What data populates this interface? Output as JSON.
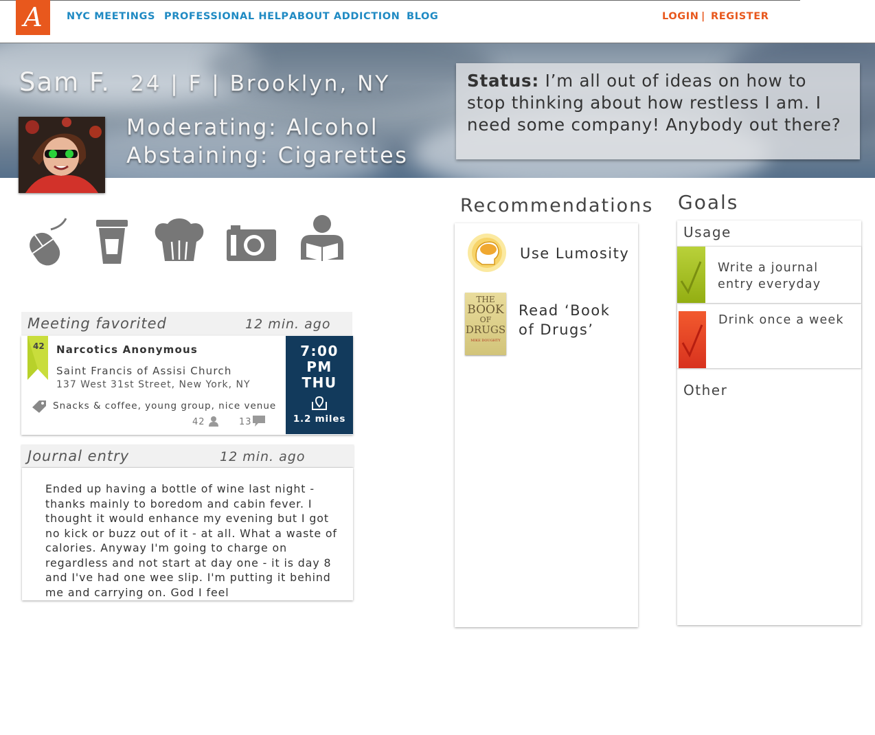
{
  "nav": {
    "logo": "A",
    "links": [
      "NYC MEETINGS",
      "PROFESSIONAL HELP",
      "ABOUT ADDICTION",
      "BLOG"
    ],
    "login": "LOGIN",
    "separator": "|",
    "register": "REGISTER"
  },
  "profile": {
    "name": "Sam F.",
    "meta": "24 | F | Brooklyn, NY",
    "moderating": "Moderating: Alcohol",
    "abstaining": "Abstaining: Cigarettes",
    "status_label": "Status:",
    "status_text": "I’m all out of ideas on how to stop thinking about how restless I am. I need some company! Anybody out there?"
  },
  "interest_icons": [
    "mouse-icon",
    "coffee-cup-icon",
    "chef-hat-icon",
    "camera-icon",
    "reading-person-icon"
  ],
  "meeting_card": {
    "header": "Meeting favorited",
    "time_ago": "12 min. ago",
    "badge_count": "42",
    "title": "Narcotics Anonymous",
    "venue": "Saint Francis of Assisi Church",
    "address": "137 West 31st Street, New York, NY",
    "tags": "Snacks & coffee, young group, nice venue",
    "attendees": "42",
    "comments": "13",
    "time": "7:00",
    "ampm": "PM",
    "day": "THU",
    "distance": "1.2 miles"
  },
  "journal_card": {
    "header": "Journal entry",
    "time_ago": "12 min. ago",
    "text": "Ended up having a bottle of wine last night - thanks mainly to boredom and cabin fever. I thought it would enhance my evening but I got no kick or buzz out of it - at all. What a waste of calories. Anyway I'm going to charge on regardless and not start at day one - it is day 8 and I've had one wee slip. I'm putting it behind me and carrying on. God I feel"
  },
  "recommendations": {
    "title": "Recommendations",
    "items": [
      {
        "label": "Use Lumosity",
        "icon": "brain-head-icon"
      },
      {
        "label": "Read ‘Book of Drugs’",
        "icon": "book-cover-icon"
      }
    ],
    "book_cover_lines": [
      "THE",
      "BOOK",
      "OF",
      "DRUGS",
      "MIKE DOUGHTY"
    ]
  },
  "goals": {
    "title": "Goals",
    "usage_label": "Usage",
    "items": [
      {
        "label": "Write a journal entry everyday",
        "status_color": "#a4c21a"
      },
      {
        "label": "Drink once a week",
        "status_color": "#e8452a"
      }
    ],
    "other_label": "Other"
  },
  "colors": {
    "brand_orange": "#e8581d",
    "nav_blue": "#1f8ac3",
    "meeting_navy": "#123a5c",
    "badge_green": "#b8d12a"
  }
}
